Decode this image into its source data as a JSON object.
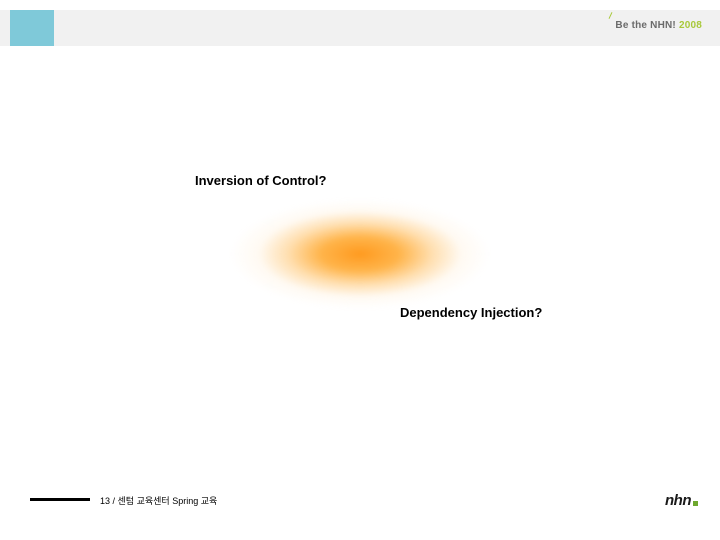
{
  "header": {
    "brand_prefix": "Be the NHN!",
    "brand_year": "2008"
  },
  "content": {
    "text_top": "Inversion of Control?",
    "text_bottom": "Dependency Injection?"
  },
  "footer": {
    "page_info": "13 / 센텀 교육센터 Spring 교육",
    "logo_text": "nhn"
  }
}
